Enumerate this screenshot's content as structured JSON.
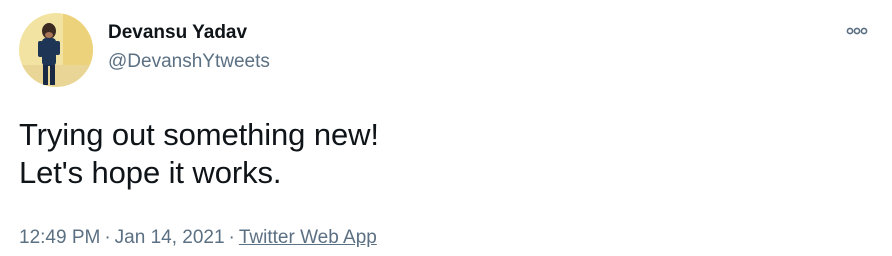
{
  "author": {
    "display_name": "Devansu Yadav",
    "handle": "@DevanshYtweets",
    "avatar_icon": "profile-photo"
  },
  "more_button": {
    "icon": "more-dots-icon"
  },
  "tweet": {
    "lines": [
      "Trying out something new!",
      "Let's hope it works."
    ]
  },
  "meta": {
    "time": "12:49 PM",
    "separator": "·",
    "date": "Jan 14, 2021",
    "source": "Twitter Web App"
  },
  "colors": {
    "text_primary": "#0f1419",
    "text_secondary": "#5b7083",
    "avatar_background": "#f5e6a8"
  }
}
